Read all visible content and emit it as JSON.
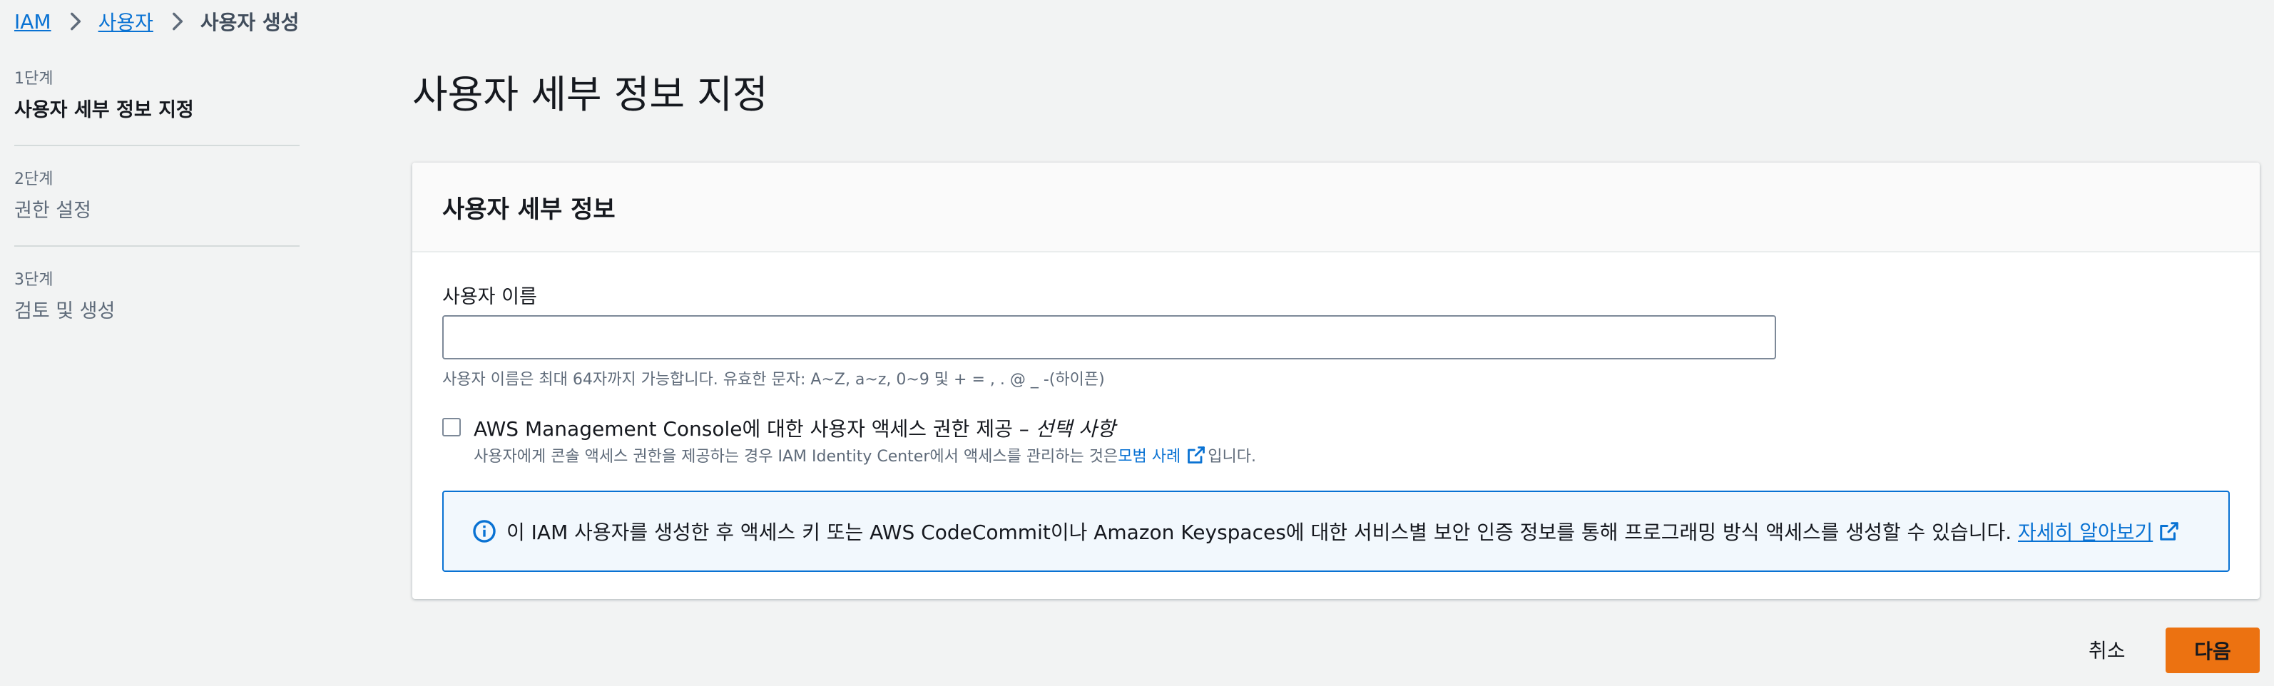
{
  "breadcrumb": {
    "items": [
      {
        "label": "IAM"
      },
      {
        "label": "사용자"
      },
      {
        "label": "사용자 생성"
      }
    ]
  },
  "steps": [
    {
      "num": "1단계",
      "title": "사용자 세부 정보 지정",
      "active": true
    },
    {
      "num": "2단계",
      "title": "권한 설정",
      "active": false
    },
    {
      "num": "3단계",
      "title": "검토 및 생성",
      "active": false
    }
  ],
  "page": {
    "title": "사용자 세부 정보 지정"
  },
  "panel": {
    "title": "사용자 세부 정보",
    "username": {
      "label": "사용자 이름",
      "value": "",
      "placeholder": "",
      "hint": "사용자 이름은 최대 64자까지 가능합니다. 유효한 문자: A~Z, a~z, 0~9 및 + = , . @ _ -(하이픈)"
    },
    "console_access": {
      "checked": false,
      "label": "AWS Management Console에 대한 사용자 액세스 권한 제공 – ",
      "label_optional": "선택 사항",
      "desc_prefix": "사용자에게 콘솔 액세스 권한을 제공하는 경우 IAM Identity Center에서 액세스를 관리하는 것은 ",
      "desc_link": "모범 사례",
      "desc_suffix": "입니다."
    },
    "info_alert": {
      "text": "이 IAM 사용자를 생성한 후 액세스 키 또는 AWS CodeCommit이나 Amazon Keyspaces에 대한 서비스별 보안 인증 정보를 통해 프로그래밍 방식 액세스를 생성할 수 있습니다. ",
      "link": "자세히 알아보기"
    }
  },
  "actions": {
    "cancel_label": "취소",
    "next_label": "다음"
  },
  "colors": {
    "background": "#f2f3f3",
    "link": "#0972d3",
    "primary_button": "#ec7211",
    "info_bg": "#f2f8fd"
  },
  "icons": {
    "breadcrumb_separator": "chevron-right-icon",
    "external_link": "external-link-icon",
    "info": "info-circle-icon"
  }
}
